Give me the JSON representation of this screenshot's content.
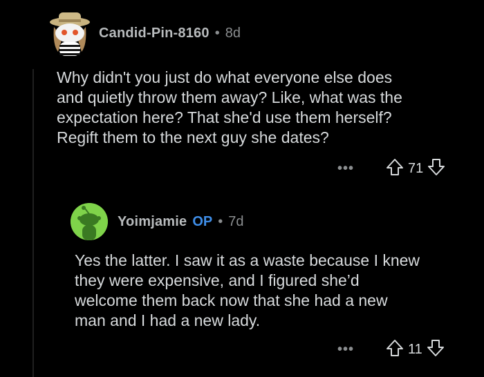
{
  "comments": [
    {
      "username": "Candid-Pin-8160",
      "separator": "•",
      "age": "8d",
      "body_lines": [
        "Why didn't you just do what everyone else does",
        "and quietly throw them away? Like, what was the",
        "expectation here? That she'd use them herself?",
        "Regift them to the next guy she dates?"
      ],
      "more_label": "•••",
      "score": "71",
      "icons": {
        "avatar": "avatar-snoo-hat-icon",
        "upvote": "arrow-up-icon",
        "downvote": "arrow-down-icon"
      }
    },
    {
      "username": "Yoimjamie",
      "op_badge": "OP",
      "separator": "•",
      "age": "7d",
      "body_lines": [
        "Yes the latter. I saw it as a waste because I knew",
        "they were expensive, and I figured she’d",
        "welcome them back now that she had a new",
        "man and I had a new lady."
      ],
      "more_label": "•••",
      "score": "11",
      "icons": {
        "avatar": "avatar-snoo-green-icon",
        "upvote": "arrow-up-icon",
        "downvote": "arrow-down-icon"
      }
    }
  ],
  "colors": {
    "background": "#000000",
    "text": "#d7dadc",
    "meta": "#8b8e90",
    "op": "#3f8ee8",
    "avatar_green": "#7fd34a"
  }
}
